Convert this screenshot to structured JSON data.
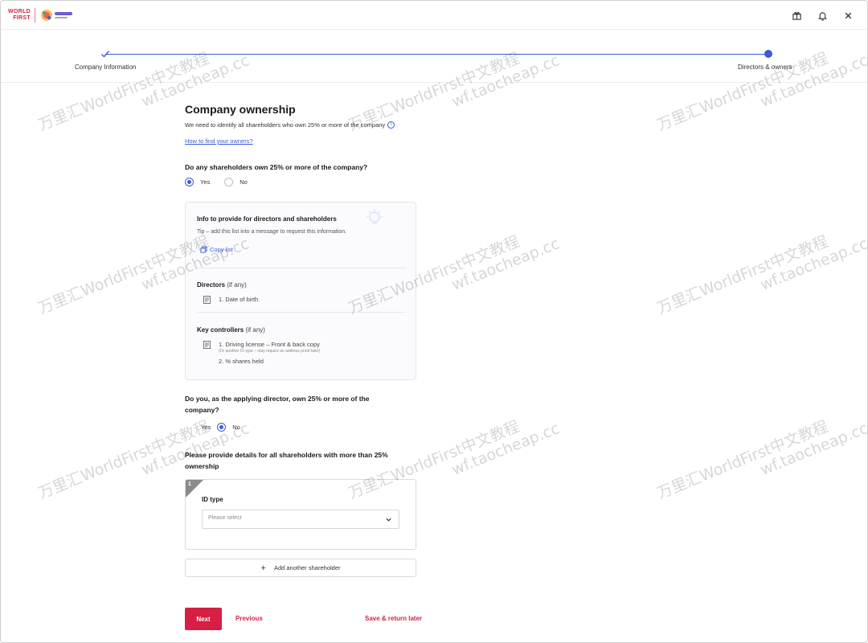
{
  "header": {
    "logo_line1": "WORLD",
    "logo_line2": "FIRST",
    "icons": [
      "gift-icon",
      "bell-icon",
      "close-icon"
    ]
  },
  "stepper": {
    "steps": [
      {
        "label": "Company Information",
        "state": "completed"
      },
      {
        "label": "Directors & owners",
        "state": "current"
      }
    ],
    "accent": "#3b5bdb"
  },
  "page": {
    "title": "Company ownership",
    "subtitle": "We need to identify all shareholders who own 25% or more of the company",
    "help_link": "How to find your owners?"
  },
  "q1": {
    "question": "Do any shareholders own 25% or more of the company?",
    "options": [
      "Yes",
      "No"
    ],
    "selected": "Yes"
  },
  "info_card": {
    "title": "Info to provide for directors and shareholders",
    "tip": "Tip – add this list into a message to request this information.",
    "copy_label": "Copy list",
    "directors_heading": "Directors",
    "directors_note": "(if any)",
    "directors_items": [
      "1. Date of birth"
    ],
    "controllers_heading": "Key controllers",
    "controllers_note": "(if any)",
    "controllers_item1": "1. Driving license – Front & back copy",
    "controllers_item1_sub": "(Or another ID type – may require an address proof later)",
    "controllers_item2": "2. % shares held"
  },
  "q2": {
    "question_line1": "Do you, as the applying director, own 25% or more of the",
    "question_line2": "company?",
    "options": [
      "Yes",
      "No"
    ],
    "selected": "No"
  },
  "shareholders": {
    "prompt_line1": "Please provide details for all shareholders with more than 25%",
    "prompt_line2": "ownership",
    "index": "1",
    "id_type_label": "ID type",
    "id_type_placeholder": "Please select",
    "add_label": "Add another shareholder"
  },
  "footer": {
    "next_label": "Next",
    "previous_label": "Previous",
    "save_label": "Save & return later",
    "brand_color": "#d61f43"
  },
  "watermark": {
    "line1": "万里汇WorldFirst中文教程",
    "line2": "wf.taocheap.cc"
  }
}
